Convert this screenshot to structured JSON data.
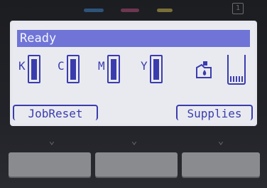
{
  "indicators": {
    "colors": {
      "cyan": "#3d7fc4",
      "magenta": "#b04a7a",
      "yellow": "#c9b24a"
    }
  },
  "corner_icon": {
    "label": "1"
  },
  "screen": {
    "status_title": "Ready",
    "inks": [
      {
        "letter": "K",
        "level_pct": 85
      },
      {
        "letter": "C",
        "level_pct": 85
      },
      {
        "letter": "M",
        "level_pct": 85
      },
      {
        "letter": "Y",
        "level_pct": 85
      }
    ],
    "waste_toner": {
      "icon": "waste-toner-icon",
      "level_pct": 20
    },
    "softkeys": {
      "left": "JobReset",
      "right": "Supplies"
    }
  },
  "colors": {
    "screen_bg": "#e9eaf0",
    "accent": "#3a3cae",
    "title_bar": "#6f74d6"
  }
}
